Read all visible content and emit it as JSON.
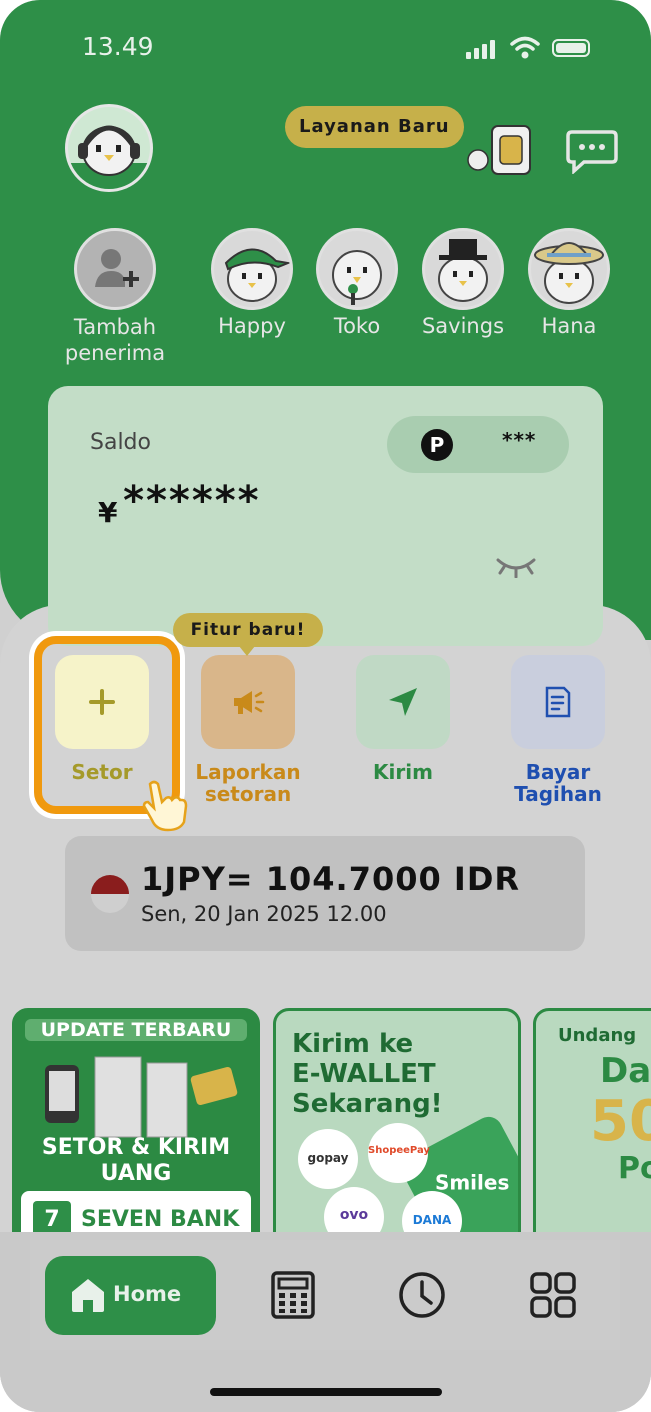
{
  "status_bar": {
    "time": "13.49"
  },
  "header": {
    "new_service_badge": "Layanan Baru"
  },
  "recipients": [
    {
      "label": "Tambah\npenerima"
    },
    {
      "label": "Happy"
    },
    {
      "label": "Toko"
    },
    {
      "label": "Savings"
    },
    {
      "label": "Hana"
    }
  ],
  "balance_card": {
    "label": "Saldo",
    "points_badge": "P",
    "points_value": "***",
    "currency": "¥",
    "masked_amount": "******"
  },
  "actions": {
    "new_feature_badge": "Fitur baru!",
    "items": [
      {
        "label": "Setor",
        "color": "#a59a2a"
      },
      {
        "label": "Laporkan\nsetoran",
        "color": "#c98a1a"
      },
      {
        "label": "Kirim",
        "color": "#2c8a43"
      },
      {
        "label": "Bayar\nTagihan",
        "color": "#1f4fb0"
      }
    ]
  },
  "exchange_rate": {
    "rate": "1JPY= 104.7000 IDR",
    "date": "Sen, 20 Jan 2025 12.00"
  },
  "banners": [
    {
      "line1": "UPDATE TERBARU",
      "line2": "SETOR & KIRIM",
      "line3": "UANG",
      "line4": "SEVEN BANK"
    },
    {
      "line1": "Kirim ke",
      "line2": "E-WALLET",
      "line3": "Sekarang!",
      "wallets": [
        "gopay",
        "ShopeePay",
        "ovo",
        "DANA"
      ],
      "app": "Smiles"
    },
    {
      "line1": "Undang",
      "line2": "Da",
      "line3": "50",
      "line4": "Po"
    }
  ],
  "bottom_nav": {
    "home_label": "Home"
  },
  "colors": {
    "brand_green": "#2e8f48",
    "highlight_orange": "#f0990e",
    "badge_gold": "#c6b04a"
  }
}
